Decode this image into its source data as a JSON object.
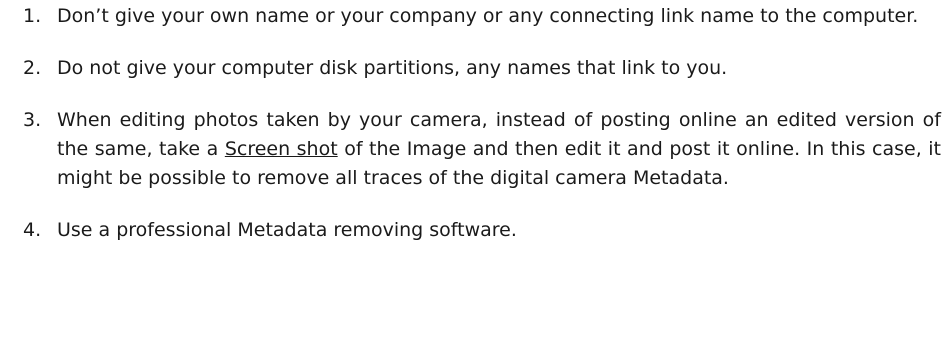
{
  "items": [
    {
      "number": "1.",
      "text": "Don’t give your own name or your company or any connecting link name to the computer."
    },
    {
      "number": "2.",
      "text": "Do not give your computer disk partitions, any names that link to you."
    },
    {
      "number": "3.",
      "text_before": "When editing photos taken by your camera, instead of posting online an edited version of the same, take a ",
      "link": "Screen shot",
      "text_after": " of the Image and then edit it and post it online. In this case, it might be possible to remove all traces of the digital camera Metadata."
    },
    {
      "number": "4.",
      "text": "Use a professional Metadata removing software."
    }
  ]
}
